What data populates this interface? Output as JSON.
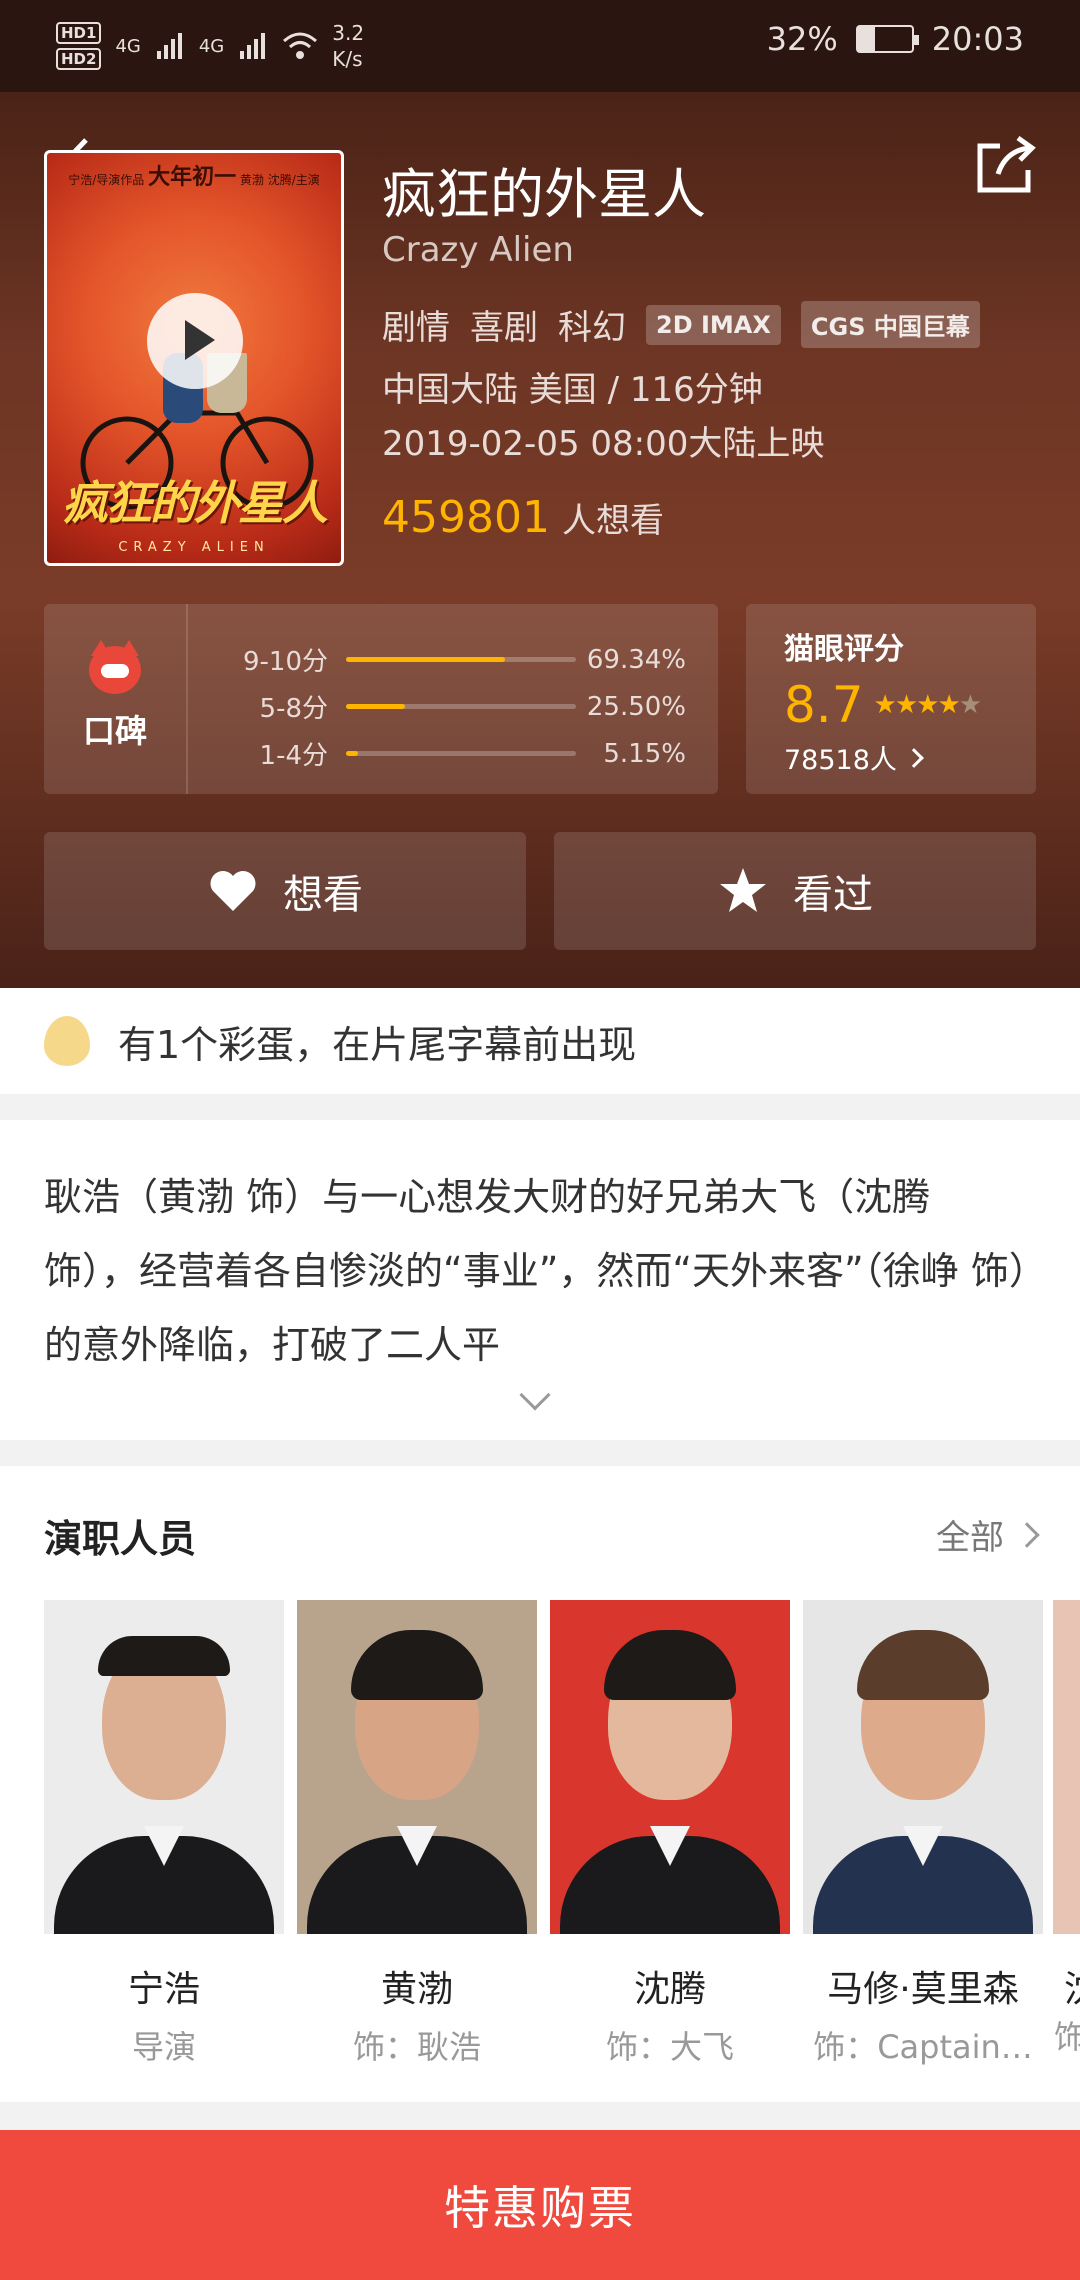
{
  "status_bar": {
    "hd1": "HD1",
    "hd2": "HD2",
    "net1": "4G",
    "net2": "4G",
    "speed_value": "3.2",
    "speed_unit": "K/s",
    "battery_pct": "32%",
    "battery_level": 0.32,
    "time": "20:03"
  },
  "movie": {
    "title": "疯狂的外星人",
    "english_title": "Crazy Alien",
    "genres": [
      "剧情",
      "喜剧",
      "科幻"
    ],
    "tags": [
      "2D IMAX",
      "CGS 中国巨幕"
    ],
    "origin_duration": "中国大陆  美国 / 116分钟",
    "release": "2019-02-05 08:00大陆上映",
    "want_count": "459801",
    "want_label": "人想看",
    "poster": {
      "top_text": "宁浩/导演作品",
      "top_big": "大年初一",
      "top_right": "黄渤 沈腾/主演",
      "title_art": "疯狂的外星人",
      "sub_art": "CRAZY ALIEN"
    }
  },
  "koubei": {
    "label": "口碑",
    "rows": [
      {
        "label": "9-10分",
        "pct": "69.34%",
        "value": 69.34
      },
      {
        "label": "5-8分",
        "pct": "25.50%",
        "value": 25.5
      },
      {
        "label": "1-4分",
        "pct": "5.15%",
        "value": 5.15
      }
    ]
  },
  "maoyan": {
    "title": "猫眼评分",
    "score": "8.7",
    "stars": "★★★★",
    "half_star": "★",
    "count": "78518人"
  },
  "actions": {
    "want_label": "想看",
    "seen_label": "看过"
  },
  "easter_egg": "有1个彩蛋，在片尾字幕前出现",
  "synopsis": "耿浩（黄渤 饰）与一心想发大财的好兄弟大飞（沈腾 饰），经营着各自惨淡的“事业”，然而“天外来客”（徐峥 饰）的意外降临，打破了二人平",
  "cast": {
    "heading": "演职人员",
    "all_label": "全部",
    "people": [
      {
        "name": "宁浩",
        "role": "导演"
      },
      {
        "name": "黄渤",
        "role": "饰：耿浩"
      },
      {
        "name": "沈腾",
        "role": "饰：大飞"
      },
      {
        "name": "马修·莫里森",
        "role": "饰：Captain…"
      }
    ],
    "partial_name": "沈",
    "partial_role": "饰"
  },
  "buy_button": "特惠购票",
  "colors": {
    "accent": "#ffb400",
    "buy": "#f04a3e",
    "hero_bg": "#6d3524"
  }
}
